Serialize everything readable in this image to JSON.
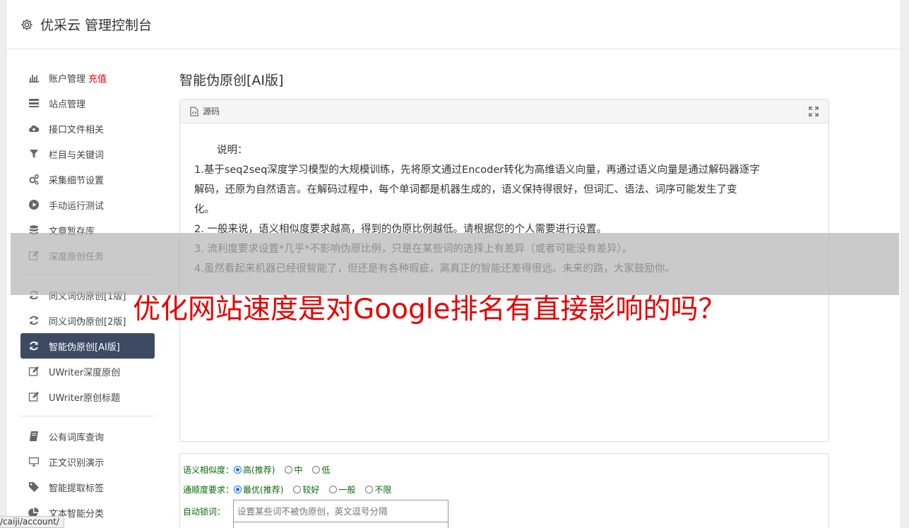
{
  "header": {
    "title": "优采云 管理控制台"
  },
  "sidebar": {
    "group1": [
      {
        "name": "nav-account",
        "icon": "bar-chart-icon",
        "label": "账户管理",
        "extra": "充值"
      },
      {
        "name": "nav-sites",
        "icon": "list-icon",
        "label": "站点管理"
      },
      {
        "name": "nav-api-files",
        "icon": "cloud-upload-icon",
        "label": "接口文件相关"
      },
      {
        "name": "nav-columns-keywords",
        "icon": "filter-icon",
        "label": "栏目与关键词"
      },
      {
        "name": "nav-collect-settings",
        "icon": "gears-icon",
        "label": "采集细节设置"
      },
      {
        "name": "nav-manual-run",
        "icon": "play-circle-icon",
        "label": "手动运行测试"
      },
      {
        "name": "nav-article-store",
        "icon": "database-icon",
        "label": "文章暂存库"
      },
      {
        "name": "nav-deep-original",
        "icon": "edit-icon",
        "label": "深度原创任务"
      }
    ],
    "group2": [
      {
        "name": "nav-synonym-1",
        "icon": "refresh-icon",
        "label": "同义词伪原创[1版]"
      },
      {
        "name": "nav-synonym-2",
        "icon": "refresh-icon",
        "label": "同义词伪原创[2版]"
      },
      {
        "name": "nav-ai-rewrite",
        "icon": "refresh-icon",
        "label": "智能伪原创[AI版]",
        "active": true
      },
      {
        "name": "nav-uwriter-deep",
        "icon": "edit-icon",
        "label": "UWriter深度原创"
      },
      {
        "name": "nav-uwriter-title",
        "icon": "edit-icon",
        "label": "UWriter原创标题"
      }
    ],
    "group3": [
      {
        "name": "nav-public-lexicon",
        "icon": "book-icon",
        "label": "公有词库查询"
      },
      {
        "name": "nav-text-recognition",
        "icon": "monitor-icon",
        "label": "正文识别演示"
      },
      {
        "name": "nav-smart-tags",
        "icon": "tag-icon",
        "label": "智能提取标签"
      },
      {
        "name": "nav-text-classify",
        "icon": "pie-chart-icon",
        "label": "文本智能分类"
      }
    ]
  },
  "main": {
    "page_title": "智能伪原创[AI版]",
    "panel": {
      "header_label": "源码",
      "intro": "说明：",
      "lines": [
        "1.基于seq2seq深度学习模型的大规模训练，先将原文通过Encoder转化为高维语义向量，再通过语义向量是通过解码器逐字",
        "解码，还原为自然语言。在解码过程中，每个单词都是机器生成的，语义保持得很好，但词汇、语法、词序可能发生了变",
        "化。",
        "2. 一般来说，语义相似度要求越高，得到的伪原比例越低。请根据您的个人需要进行设置。",
        "3. 流利度要求设置*几乎*不影响伪原比例，只是在某些词的选择上有差异（或者可能没有差异）。",
        "4.虽然看起来机器已经很智能了，但还是有各种瑕疵，离真正的智能还差得很远。未来的路，大家鼓励你。"
      ]
    },
    "form": {
      "similarity": {
        "label": "语义相似度：",
        "options": [
          "高(推荐)",
          "中",
          "低"
        ]
      },
      "fluency": {
        "label": "通顺度要求：",
        "options": [
          "最优(推荐)",
          "较好",
          "一般",
          "不限"
        ]
      },
      "lock": {
        "label": "自动锁词：",
        "placeholder": "设置某些词不被伪原创，英文逗号分隔"
      }
    }
  },
  "overlay": {
    "headline": "优化网站速度是对Google排名有直接影响的吗？"
  },
  "status_bar": {
    "url": "/caiji/account/"
  },
  "colors": {
    "accent_active": "#3d4a63",
    "recharge": "#ee0000",
    "headline": "#e80000",
    "form_label": "#086a08"
  }
}
